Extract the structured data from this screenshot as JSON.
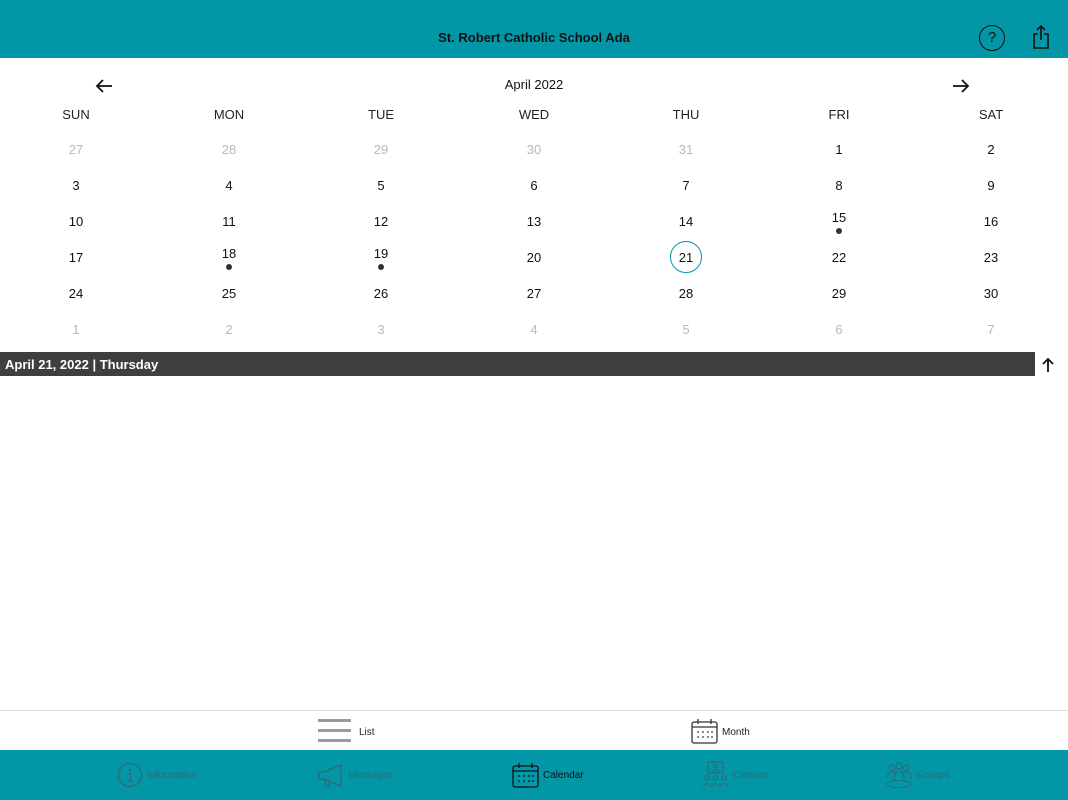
{
  "header": {
    "title": "St. Robert Catholic School Ada",
    "help_icon": "help-circle-icon",
    "help_glyph": "?",
    "share_icon": "share-icon"
  },
  "calendar": {
    "month_label": "April 2022",
    "prev_icon": "arrow-left-icon",
    "next_icon": "arrow-right-icon",
    "weekdays": [
      "SUN",
      "MON",
      "TUE",
      "WED",
      "THU",
      "FRI",
      "SAT"
    ],
    "weeks": [
      [
        {
          "d": "27",
          "m": true
        },
        {
          "d": "28",
          "m": true
        },
        {
          "d": "29",
          "m": true
        },
        {
          "d": "30",
          "m": true
        },
        {
          "d": "31",
          "m": true
        },
        {
          "d": "1"
        },
        {
          "d": "2"
        }
      ],
      [
        {
          "d": "3"
        },
        {
          "d": "4"
        },
        {
          "d": "5"
        },
        {
          "d": "6"
        },
        {
          "d": "7"
        },
        {
          "d": "8"
        },
        {
          "d": "9"
        }
      ],
      [
        {
          "d": "10"
        },
        {
          "d": "11"
        },
        {
          "d": "12"
        },
        {
          "d": "13"
        },
        {
          "d": "14"
        },
        {
          "d": "15",
          "e": true
        },
        {
          "d": "16"
        }
      ],
      [
        {
          "d": "17"
        },
        {
          "d": "18",
          "e": true
        },
        {
          "d": "19",
          "e": true
        },
        {
          "d": "20"
        },
        {
          "d": "21",
          "sel": true
        },
        {
          "d": "22"
        },
        {
          "d": "23"
        }
      ],
      [
        {
          "d": "24"
        },
        {
          "d": "25"
        },
        {
          "d": "26"
        },
        {
          "d": "27"
        },
        {
          "d": "28"
        },
        {
          "d": "29"
        },
        {
          "d": "30"
        }
      ],
      [
        {
          "d": "1",
          "m": true
        },
        {
          "d": "2",
          "m": true
        },
        {
          "d": "3",
          "m": true
        },
        {
          "d": "4",
          "m": true
        },
        {
          "d": "5",
          "m": true
        },
        {
          "d": "6",
          "m": true
        },
        {
          "d": "7",
          "m": true
        }
      ]
    ],
    "selected_date_label": "April 21, 2022 | Thursday",
    "scroll_up_icon": "arrow-up-icon"
  },
  "view_toggle": {
    "list_label": "List",
    "list_icon": "list-icon",
    "month_label": "Month",
    "month_icon": "calendar-icon"
  },
  "tabs": [
    {
      "label": "Information",
      "icon": "info-icon",
      "active": false
    },
    {
      "label": "Messages",
      "icon": "megaphone-icon",
      "active": false
    },
    {
      "label": "Calendar",
      "icon": "calendar-icon",
      "active": true
    },
    {
      "label": "Classes",
      "icon": "classes-icon",
      "active": false
    },
    {
      "label": "Groups",
      "icon": "groups-icon",
      "active": false
    }
  ],
  "colors": {
    "accent": "#0396a6",
    "date_bar": "#3f3f3f",
    "muted_day": "#b8b8b8"
  }
}
